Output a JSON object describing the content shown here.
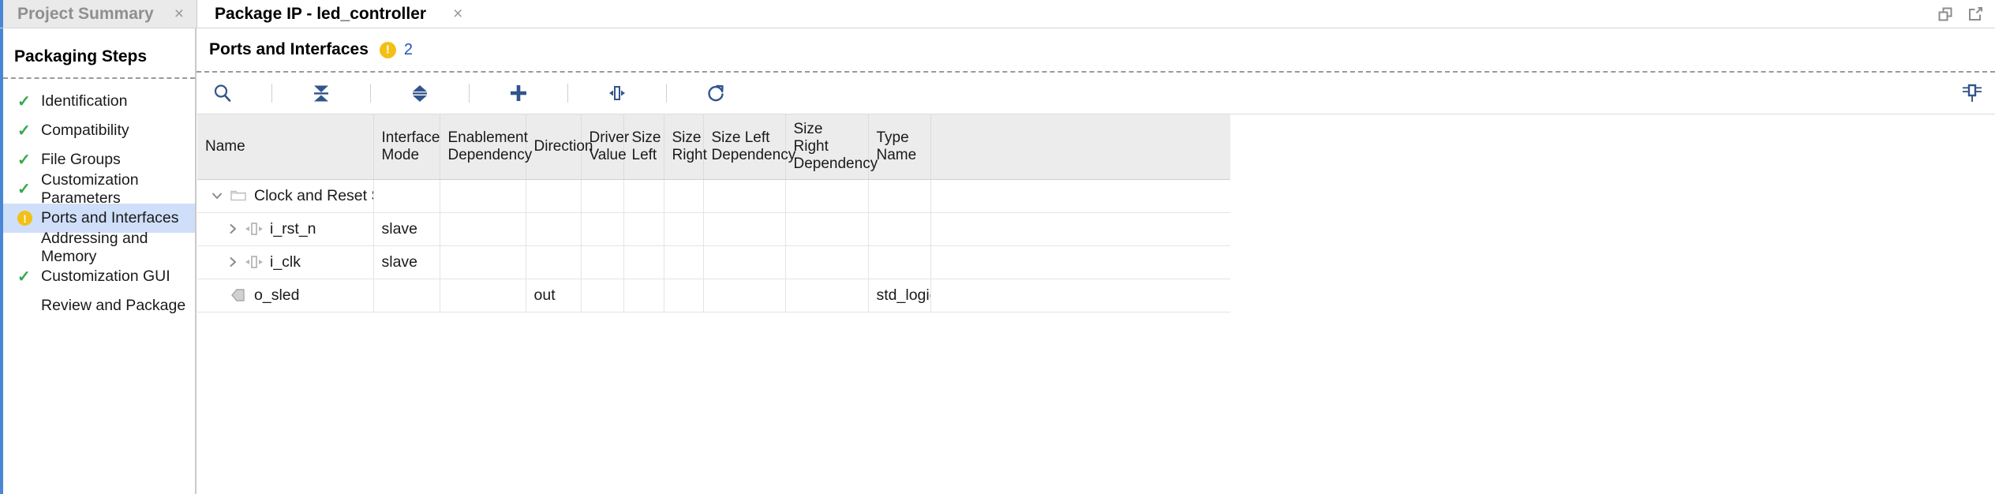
{
  "window": {
    "controls": [
      {
        "name": "restore-windows-icon",
        "label": "Restore Windows"
      },
      {
        "name": "float-window-icon",
        "label": "Float Window"
      }
    ]
  },
  "tabs": [
    {
      "label": "Project Summary",
      "active": false,
      "close": "×"
    },
    {
      "label": "Package IP - led_controller",
      "active": true,
      "close": "×"
    }
  ],
  "sidebar": {
    "header": "Packaging Steps",
    "items": [
      {
        "label": "Identification",
        "status": "check",
        "selected": false
      },
      {
        "label": "Compatibility",
        "status": "check",
        "selected": false
      },
      {
        "label": "File Groups",
        "status": "check",
        "selected": false
      },
      {
        "label": "Customization Parameters",
        "status": "check",
        "selected": false
      },
      {
        "label": "Ports and Interfaces",
        "status": "warning",
        "selected": true
      },
      {
        "label": "Addressing and Memory",
        "status": "none",
        "selected": false
      },
      {
        "label": "Customization GUI",
        "status": "check",
        "selected": false
      },
      {
        "label": "Review and Package",
        "status": "none",
        "selected": false
      }
    ]
  },
  "panel": {
    "title": "Ports and Interfaces",
    "warning_count": "2",
    "toolbar": [
      {
        "name": "search-icon",
        "label": "Search"
      },
      {
        "name": "collapse-all-icon",
        "label": "Collapse All"
      },
      {
        "name": "expand-all-icon",
        "label": "Expand All"
      },
      {
        "name": "add-interface-icon",
        "label": "Add Interface"
      },
      {
        "name": "auto-infer-interface-icon",
        "label": "Auto Infer Interface"
      },
      {
        "name": "refresh-icon",
        "label": "Refresh"
      }
    ],
    "dock_button": {
      "name": "dock-panel-icon",
      "label": "Dock / Undock Panel"
    }
  },
  "table": {
    "columns": [
      {
        "key": "name",
        "label": "Name",
        "label2": ""
      },
      {
        "key": "mode",
        "label": "Interface",
        "label2": "Mode"
      },
      {
        "key": "enable_dep",
        "label": "Enablement",
        "label2": "Dependency"
      },
      {
        "key": "direction",
        "label": "Direction",
        "label2": ""
      },
      {
        "key": "driver",
        "label": "Driver",
        "label2": "Value"
      },
      {
        "key": "size_left",
        "label": "Size",
        "label2": "Left"
      },
      {
        "key": "size_right",
        "label": "Size",
        "label2": "Right"
      },
      {
        "key": "sl_dep",
        "label": "Size Left",
        "label2": "Dependency"
      },
      {
        "key": "sr_dep",
        "label": "Size Right",
        "label2": "Dependency"
      },
      {
        "key": "type_name",
        "label": "Type",
        "label2": "Name"
      }
    ],
    "rows": [
      {
        "name": "Clock and Reset Signals",
        "indent": 0,
        "twisty": "down",
        "icon": "folder-icon",
        "mode": "",
        "enable_dep": "",
        "direction": "",
        "driver": "",
        "size_left": "",
        "size_right": "",
        "sl_dep": "",
        "sr_dep": "",
        "type_name": ""
      },
      {
        "name": "i_rst_n",
        "indent": 1,
        "twisty": "right",
        "icon": "interface-icon",
        "mode": "slave",
        "enable_dep": "",
        "direction": "",
        "driver": "",
        "size_left": "",
        "size_right": "",
        "sl_dep": "",
        "sr_dep": "",
        "type_name": ""
      },
      {
        "name": "i_clk",
        "indent": 1,
        "twisty": "right",
        "icon": "interface-icon",
        "mode": "slave",
        "enable_dep": "",
        "direction": "",
        "driver": "",
        "size_left": "",
        "size_right": "",
        "sl_dep": "",
        "sr_dep": "",
        "type_name": ""
      },
      {
        "name": "o_sled",
        "indent": 0,
        "twisty": "none",
        "icon": "output-port-icon",
        "mode": "",
        "enable_dep": "",
        "direction": "out",
        "driver": "",
        "size_left": "",
        "size_right": "",
        "sl_dep": "",
        "sr_dep": "",
        "type_name": "std_logic"
      }
    ]
  },
  "colors": {
    "accent_blue": "#4a86d6",
    "link_blue": "#1a56c4",
    "warning_yellow": "#f2c016",
    "check_green": "#36a84b",
    "selection_blue": "#cfdffa",
    "toolbar_icon": "#32548c",
    "header_gray": "#ececec"
  }
}
